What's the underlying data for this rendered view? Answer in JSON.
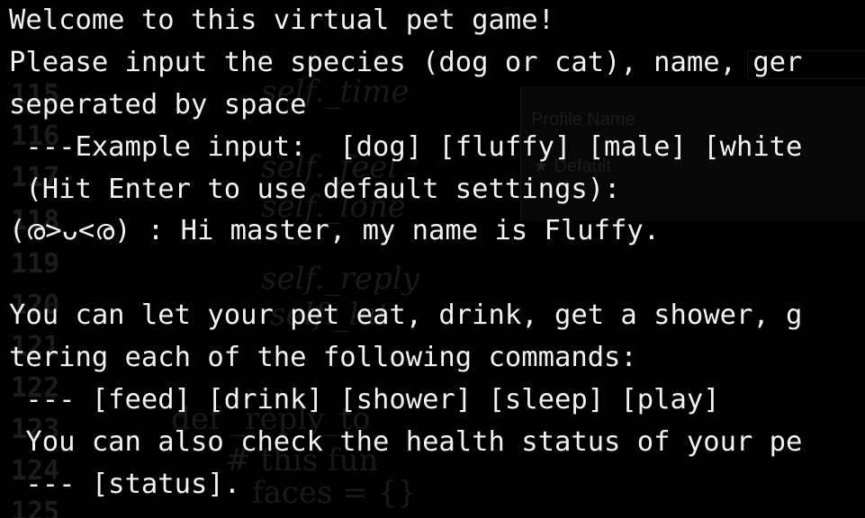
{
  "terminal": {
    "background": "#000000",
    "foreground": "#f2f2f2",
    "lines": [
      "Welcome to this virtual pet game!",
      "Please input the species (dog or cat), name, ger",
      "seperated by space",
      " ---Example input:  [dog] [fluffy] [male] [white",
      " (Hit Enter to use default settings):",
      "(ര>ᴗ<ര) : Hi master, my name is Fluffy.",
      "",
      "You can let your pet eat, drink, get a shower, g",
      "tering each of the following commands:",
      " --- [feed] [drink] [shower] [sleep] [play]",
      " You can also check the health status of your pe",
      " --- [status]."
    ]
  },
  "background_window": {
    "line_numbers": [
      "115",
      "116",
      "117",
      "118",
      "119",
      "120",
      "121",
      "122",
      "123",
      "124",
      "125"
    ],
    "code_fragments": [
      "self._time",
      "self._feel",
      "self._lone",
      "self._reply",
      "self._lat",
      "def _reply_to_",
      "# this fun",
      "faces = {}"
    ],
    "profile_panel_title": "Profile Name",
    "profile_panel_item": "★ Default"
  }
}
